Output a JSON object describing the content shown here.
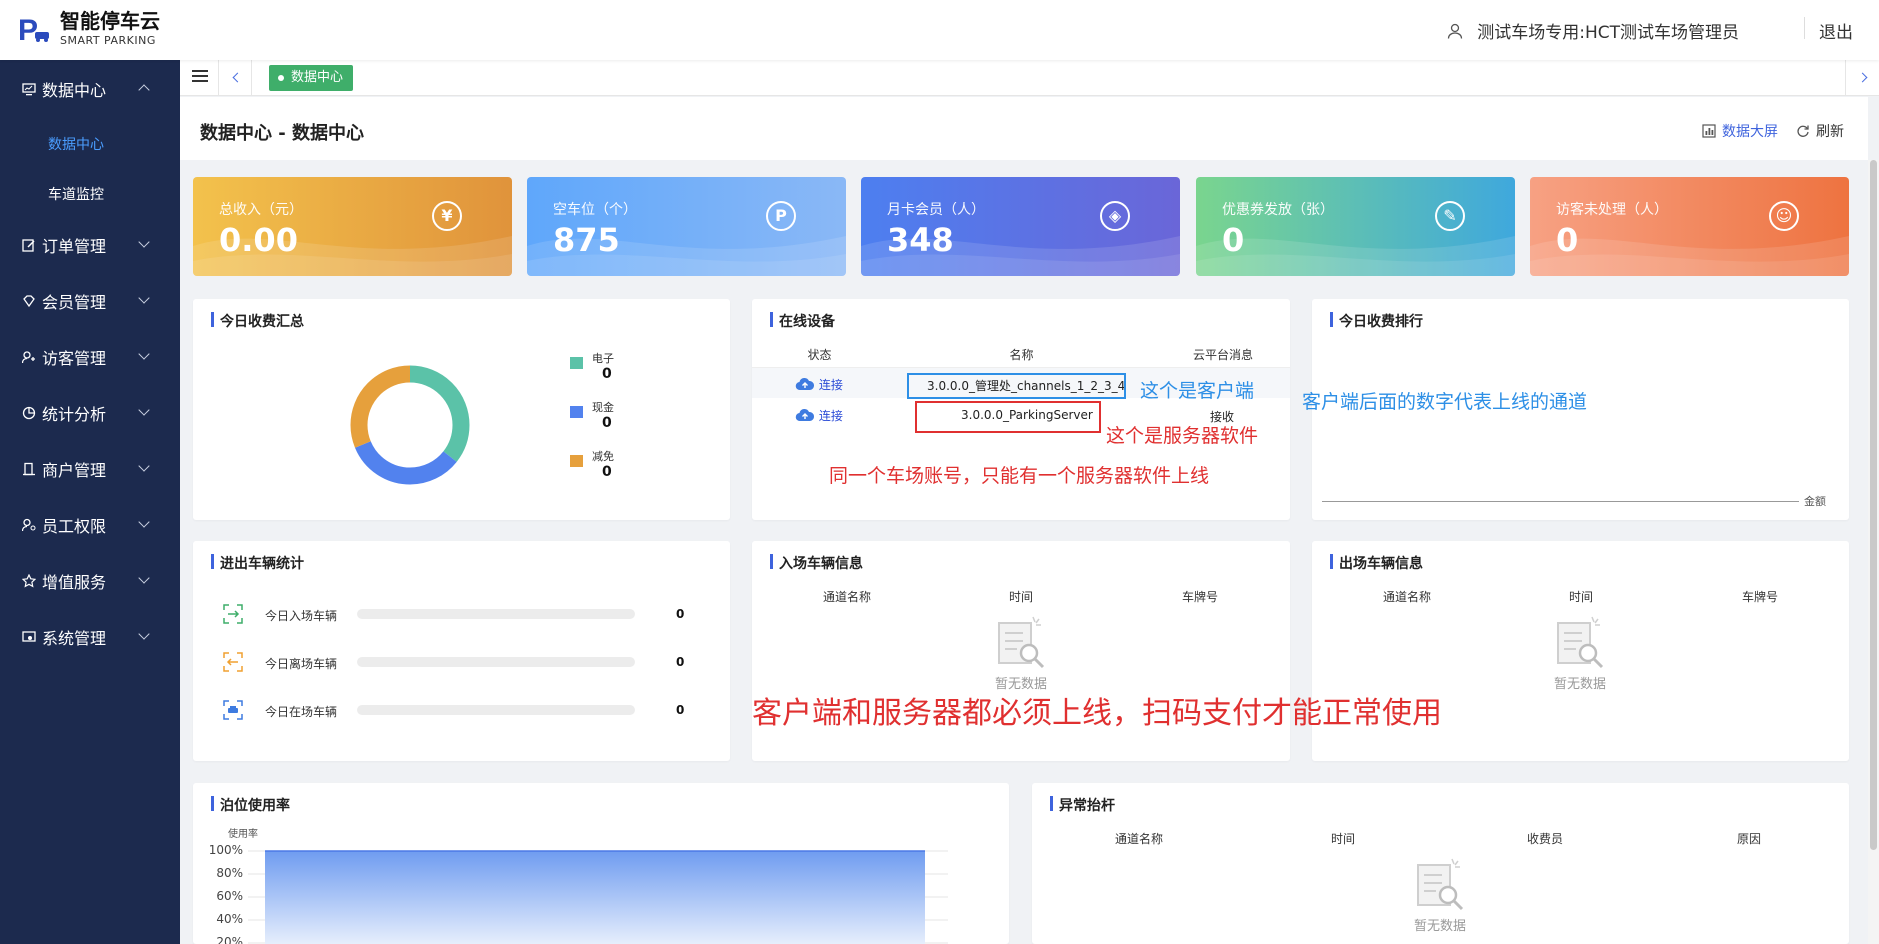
{
  "header": {
    "logo_title": "智能停车云",
    "logo_subtitle": "SMART PARKING",
    "user": "测试车场专用:HCT测试车场管理员",
    "logout": "退出"
  },
  "sidebar": {
    "groups": [
      {
        "label": "数据中心",
        "icon": "monitor-icon",
        "expanded": true,
        "children": [
          {
            "label": "数据中心",
            "active": true
          },
          {
            "label": "车道监控",
            "active": false
          }
        ]
      },
      {
        "label": "订单管理",
        "icon": "edit-icon"
      },
      {
        "label": "会员管理",
        "icon": "diamond-icon"
      },
      {
        "label": "访客管理",
        "icon": "visitor-icon"
      },
      {
        "label": "统计分析",
        "icon": "pie-icon"
      },
      {
        "label": "商户管理",
        "icon": "building-icon"
      },
      {
        "label": "员工权限",
        "icon": "staff-icon"
      },
      {
        "label": "增值服务",
        "icon": "star-icon"
      },
      {
        "label": "系统管理",
        "icon": "settings-icon"
      }
    ]
  },
  "tabs": {
    "active": "数据中心"
  },
  "page": {
    "title": "数据中心 - 数据中心",
    "big_screen": "数据大屏",
    "refresh": "刷新"
  },
  "stats": [
    {
      "label": "总收入（元）",
      "value": "0.00",
      "icon": "yuan-icon",
      "glyph": "¥",
      "color_from": "#f3c24c",
      "color_to": "#e0933b"
    },
    {
      "label": "空车位（个）",
      "value": "875",
      "icon": "parking-icon",
      "glyph": "P",
      "color_from": "#5fa7fb",
      "color_to": "#8ab8f6"
    },
    {
      "label": "月卡会员（人）",
      "value": "348",
      "icon": "member-icon",
      "glyph": "◈",
      "color_from": "#4d7ff0",
      "color_to": "#6a66d8"
    },
    {
      "label": "优惠券发放（张）",
      "value": "0",
      "icon": "coupon-icon",
      "glyph": "✎",
      "color_from": "#7ad58e",
      "color_to": "#3fa8dd"
    },
    {
      "label": "访客未处理（人）",
      "value": "0",
      "icon": "visitor-icon",
      "glyph": "☺",
      "color_from": "#f7a183",
      "color_to": "#ee7340"
    }
  ],
  "income_summary": {
    "title": "今日收费汇总",
    "legend": [
      {
        "label": "电子",
        "value": "0",
        "color": "#5bc2a8"
      },
      {
        "label": "现金",
        "value": "0",
        "color": "#5282ee"
      },
      {
        "label": "减免",
        "value": "0",
        "color": "#e6a03c"
      }
    ]
  },
  "online_devices": {
    "title": "在线设备",
    "headers": [
      "状态",
      "名称",
      "云平台消息"
    ],
    "rows": [
      {
        "status": "连接",
        "name": "3.0.0.0_管理处_channels_1_2_3_4",
        "message": ""
      },
      {
        "status": "连接",
        "name": "3.0.0.0_ParkingServer",
        "message": "接收"
      }
    ]
  },
  "income_rank": {
    "title": "今日收费排行",
    "axis_label": "金额"
  },
  "vehicle_stats": {
    "title": "进出车辆统计",
    "rows": [
      {
        "label": "今日入场车辆",
        "value": "0",
        "icon": "enter-icon",
        "color": "#3fae6a"
      },
      {
        "label": "今日离场车辆",
        "value": "0",
        "icon": "exit-icon",
        "color": "#f0a030"
      },
      {
        "label": "今日在场车辆",
        "value": "0",
        "icon": "car-icon",
        "color": "#3e7be0"
      }
    ]
  },
  "entry_info": {
    "title": "入场车辆信息",
    "headers": [
      "通道名称",
      "时间",
      "车牌号"
    ],
    "empty": "暂无数据"
  },
  "exit_info": {
    "title": "出场车辆信息",
    "headers": [
      "通道名称",
      "时间",
      "车牌号"
    ],
    "empty": "暂无数据"
  },
  "occupancy": {
    "title": "泊位使用率",
    "ylabel": "使用率",
    "ticks": [
      "100%",
      "80%",
      "60%",
      "40%",
      "20%"
    ]
  },
  "abnormal": {
    "title": "异常抬杆",
    "headers": [
      "通道名称",
      "时间",
      "收费员",
      "原因"
    ],
    "empty": "暂无数据"
  },
  "annotations": {
    "client": "这个是客户端",
    "client_note": "客户端后面的数字代表上线的通道",
    "server": "这个是服务器软件",
    "one_server": "同一个车场账号，只能有一个服务器软件上线",
    "both_online": "客户端和服务器都必须上线，扫码支付才能正常使用"
  }
}
